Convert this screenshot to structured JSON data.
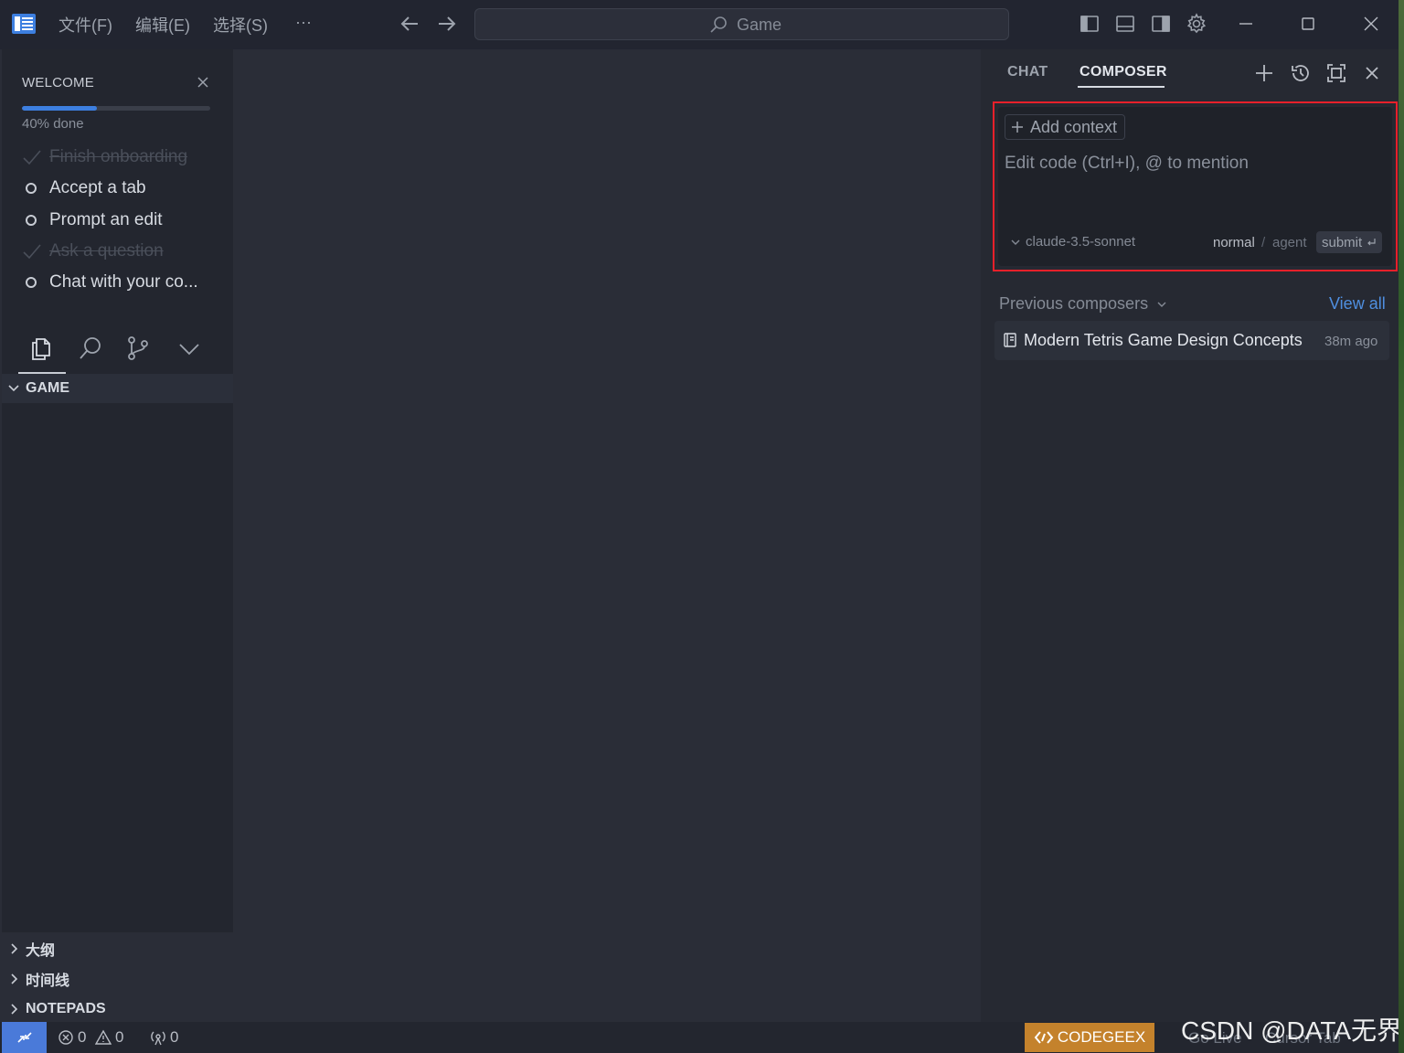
{
  "titlebar": {
    "menus": [
      "文件(F)",
      "编辑(E)",
      "选择(S)"
    ],
    "more": "···",
    "search_text": "Game"
  },
  "sidebar": {
    "welcome_title": "WELCOME",
    "progress_percent": 40,
    "progress_text": "40% done",
    "tasks": [
      {
        "label": "Finish onboarding",
        "done": true
      },
      {
        "label": "Accept a tab",
        "done": false
      },
      {
        "label": "Prompt an edit",
        "done": false
      },
      {
        "label": "Ask a question",
        "done": true
      },
      {
        "label": "Chat with your co...",
        "done": false
      }
    ],
    "explorer_section": "GAME",
    "bottom_sections": [
      "大纲",
      "时间线",
      "NOTEPADS"
    ]
  },
  "panel": {
    "tabs": {
      "chat": "CHAT",
      "composer": "COMPOSER"
    },
    "add_context": "Add context",
    "prompt_placeholder": "Edit code (Ctrl+I), @ to mention",
    "model": "claude-3.5-sonnet",
    "mode_normal": "normal",
    "mode_separator": "/",
    "mode_agent": "agent",
    "submit_label": "submit",
    "previous_label": "Previous composers",
    "view_all": "View all",
    "previous_items": [
      {
        "title": "Modern Tetris Game Design Concepts",
        "time": "38m ago"
      }
    ]
  },
  "statusbar": {
    "errors": "0",
    "warnings": "0",
    "ports": "0",
    "codegeex": "CODEGEEX",
    "go_live": "Go Live",
    "cursor_tab": "Cursor Tab",
    "watermark": "CSDN @DATA无界"
  },
  "colors": {
    "accent_blue": "#3d7fe0",
    "highlight_red": "#e8202a",
    "codegeex_orange": "#c4822c"
  }
}
